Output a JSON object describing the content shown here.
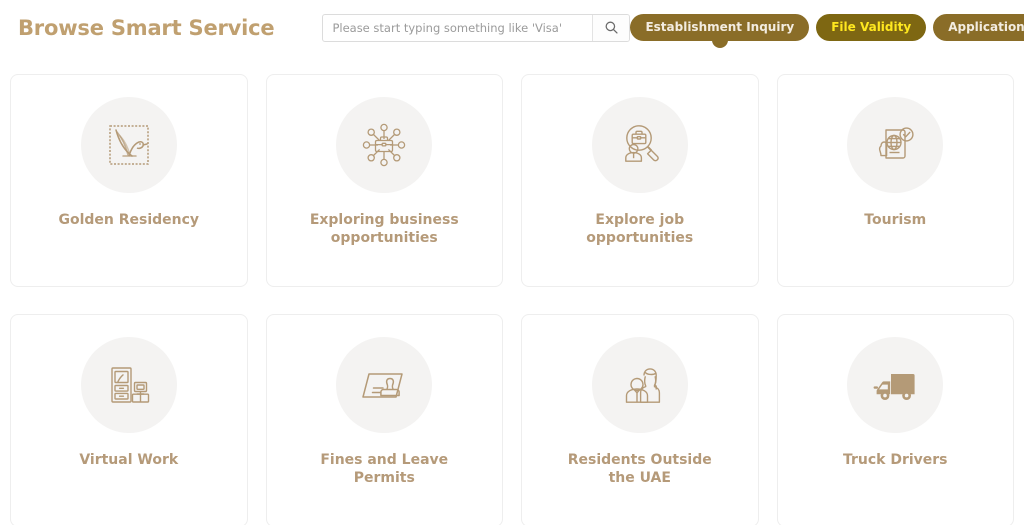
{
  "header": {
    "title": "Browse Smart Service",
    "search": {
      "placeholder": "Please start typing something like 'Visa'",
      "value": "",
      "button_icon": "search-icon"
    },
    "pills": [
      {
        "label": "Establishment Inquiry",
        "active": true,
        "style": "normal"
      },
      {
        "label": "File Validity",
        "active": false,
        "style": "highlight"
      },
      {
        "label": "Application Tracking",
        "active": false,
        "style": "normal"
      }
    ]
  },
  "colors": {
    "title": "#c0a070",
    "card_label": "#b59a79",
    "icon_stroke": "#b49a77",
    "pill_bg": "#8a6d28",
    "pill_alt_bg": "#7e6712",
    "pill_alt_text": "#ffe81f",
    "icon_circle_bg": "#f4f3f2",
    "card_border": "#eeeeee"
  },
  "cards": [
    {
      "label": "Golden Residency",
      "icon": "falcon-frame-icon"
    },
    {
      "label": "Exploring business opportunities",
      "icon": "business-network-icon"
    },
    {
      "label": "Explore job opportunities",
      "icon": "job-search-icon"
    },
    {
      "label": "Tourism",
      "icon": "passport-globe-icon"
    },
    {
      "label": "Virtual Work",
      "icon": "home-office-icon"
    },
    {
      "label": "Fines and Leave Permits",
      "icon": "stamp-document-icon"
    },
    {
      "label": "Residents Outside the UAE",
      "icon": "two-people-icon"
    },
    {
      "label": "Truck Drivers",
      "icon": "truck-icon"
    }
  ]
}
